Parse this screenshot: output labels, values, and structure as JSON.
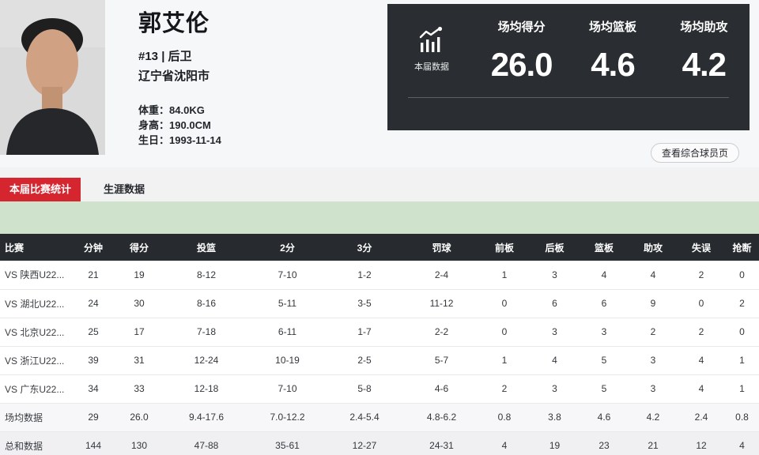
{
  "player": {
    "name": "郭艾伦",
    "jersey_position": "#13 | 后卫",
    "hometown": "辽宁省沈阳市",
    "separator": "：",
    "details": [
      {
        "label": "体重",
        "value": "84.0KG"
      },
      {
        "label": "身高",
        "value": "190.0CM"
      },
      {
        "label": "生日",
        "value": "1993-11-14"
      }
    ]
  },
  "stats_panel": {
    "icon": "trend-bar-chart-icon",
    "caption": "本届数据",
    "stats": [
      {
        "label": "场均得分",
        "value": "26.0"
      },
      {
        "label": "场均篮板",
        "value": "4.6"
      },
      {
        "label": "场均助攻",
        "value": "4.2"
      }
    ]
  },
  "profile_button_label": "查看综合球员页",
  "tabs": [
    {
      "label": "本届比赛统计",
      "active": true
    },
    {
      "label": "生涯数据",
      "active": false
    }
  ],
  "table": {
    "columns": [
      "比赛",
      "分钟",
      "得分",
      "投篮",
      "2分",
      "3分",
      "罚球",
      "前板",
      "后板",
      "篮板",
      "助攻",
      "失误",
      "抢断"
    ],
    "rows": [
      [
        "VS 陕西U22...",
        "21",
        "19",
        "8-12",
        "7-10",
        "1-2",
        "2-4",
        "1",
        "3",
        "4",
        "4",
        "2",
        "0"
      ],
      [
        "VS 湖北U22...",
        "24",
        "30",
        "8-16",
        "5-11",
        "3-5",
        "11-12",
        "0",
        "6",
        "6",
        "9",
        "0",
        "2"
      ],
      [
        "VS 北京U22...",
        "25",
        "17",
        "7-18",
        "6-11",
        "1-7",
        "2-2",
        "0",
        "3",
        "3",
        "2",
        "2",
        "0"
      ],
      [
        "VS 浙江U22...",
        "39",
        "31",
        "12-24",
        "10-19",
        "2-5",
        "5-7",
        "1",
        "4",
        "5",
        "3",
        "4",
        "1"
      ],
      [
        "VS 广东U22...",
        "34",
        "33",
        "12-18",
        "7-10",
        "5-8",
        "4-6",
        "2",
        "3",
        "5",
        "3",
        "4",
        "1"
      ],
      [
        "场均数据",
        "29",
        "26.0",
        "9.4-17.6",
        "7.0-12.2",
        "2.4-5.4",
        "4.8-6.2",
        "0.8",
        "3.8",
        "4.6",
        "4.2",
        "2.4",
        "0.8"
      ],
      [
        "总和数据",
        "144",
        "130",
        "47-88",
        "35-61",
        "12-27",
        "24-31",
        "4",
        "19",
        "23",
        "21",
        "12",
        "4"
      ]
    ],
    "avg_row_index": 5,
    "sum_row_index": 6
  },
  "colors": {
    "accent_red": "#d5252f",
    "panel_dark": "#2a2e32",
    "table_header_dark": "#272b2f",
    "band_green": "#cfe2cc",
    "hero_bg": "#f6f7f9"
  }
}
